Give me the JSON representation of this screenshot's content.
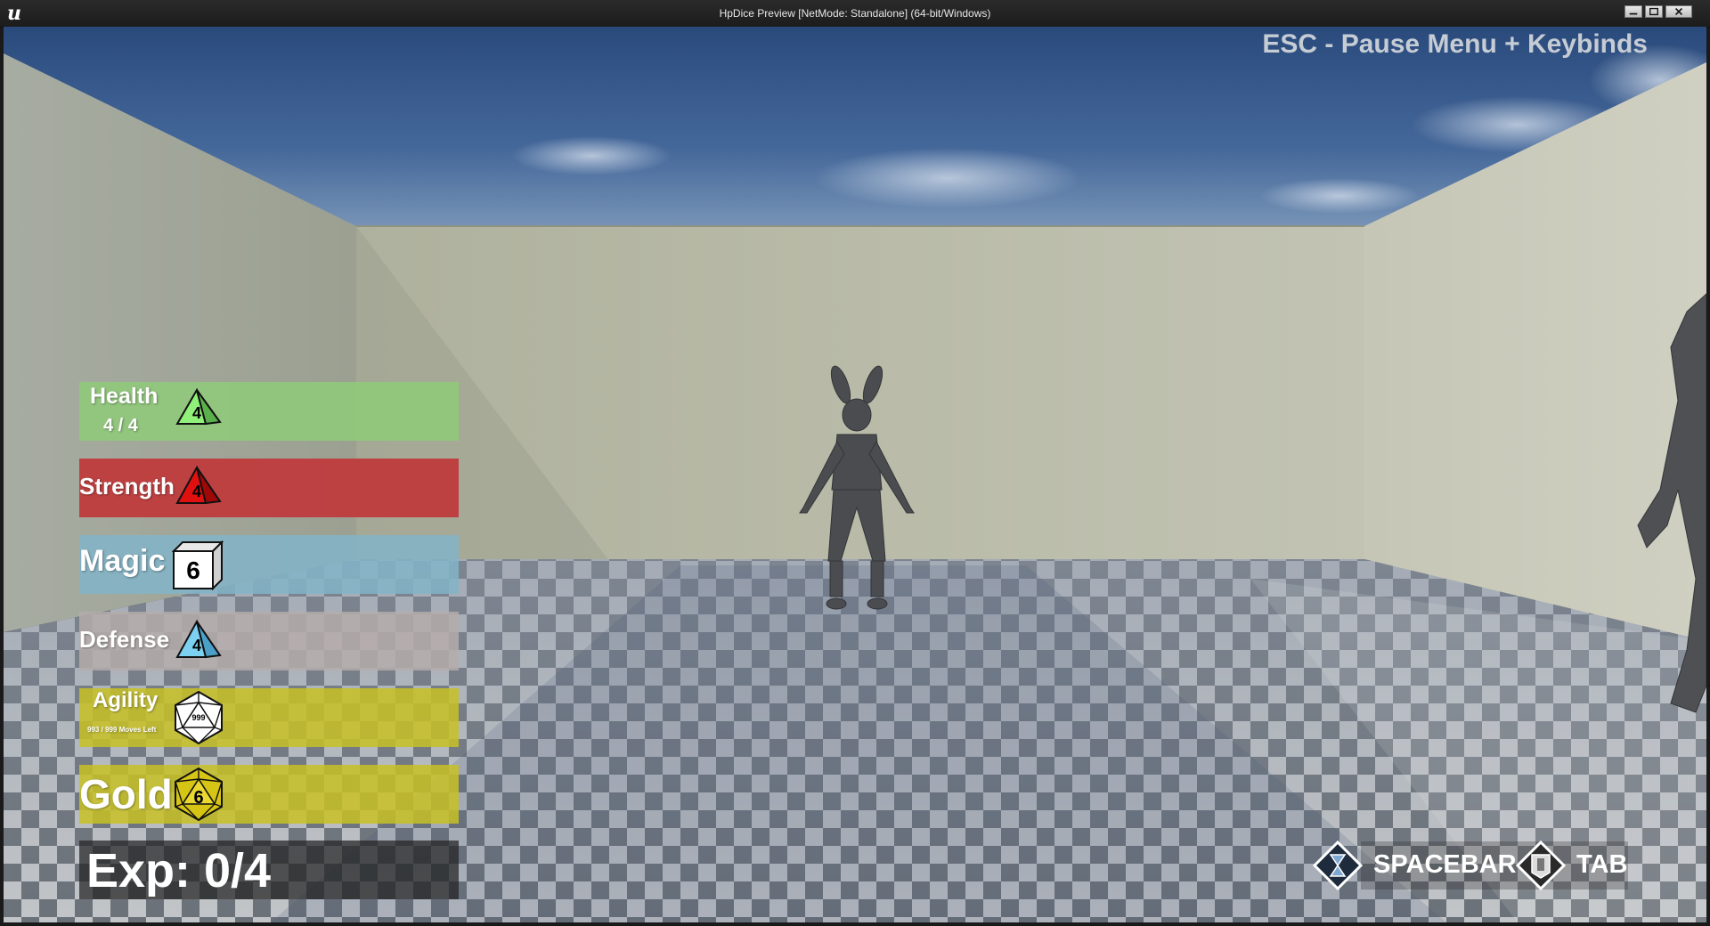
{
  "window": {
    "title": "HpDice Preview [NetMode: Standalone]  (64-bit/Windows)",
    "logo_text": "u"
  },
  "hud": {
    "esc_hint": "ESC - Pause Menu + Keybinds",
    "stats": [
      {
        "key": "health",
        "label": "Health",
        "sub": "4 / 4",
        "die": "d4",
        "die_value": "4",
        "bar_color": "#8fc97a",
        "die_color": "#90f07a"
      },
      {
        "key": "strength",
        "label": "Strength",
        "die": "d4",
        "die_value": "4",
        "bar_color": "#c0383b",
        "die_color": "#e01010"
      },
      {
        "key": "magic",
        "label": "Magic",
        "die": "d6",
        "die_value": "6",
        "bar_color": "#82b4c8",
        "die_color": "#ffffff"
      },
      {
        "key": "defense",
        "label": "Defense",
        "die": "d4",
        "die_value": "4",
        "bar_color": "#b5acaa",
        "die_color": "#7cd0f0"
      },
      {
        "key": "agility",
        "label": "Agility",
        "sub": "993 / 999 Moves Left",
        "die": "d20",
        "die_value": "999",
        "bar_color": "#c8c125",
        "die_color": "#ffffff"
      },
      {
        "key": "gold",
        "label": "Gold",
        "die": "d20",
        "die_value": "6",
        "bar_color": "#c8c125",
        "die_color": "#d6c515"
      }
    ],
    "exp": "Exp: 0/4",
    "keys": [
      {
        "label": "SPACEBAR",
        "icon": "hourglass-icon"
      },
      {
        "label": "TAB",
        "icon": "armor-icon"
      }
    ]
  },
  "colors": {
    "sky_top": "#2a4d80",
    "sky_bottom": "#6f8fb6",
    "wall": "#b6b8a6",
    "floor_dark": "#5a6068",
    "floor_light": "#b9bcc0"
  }
}
